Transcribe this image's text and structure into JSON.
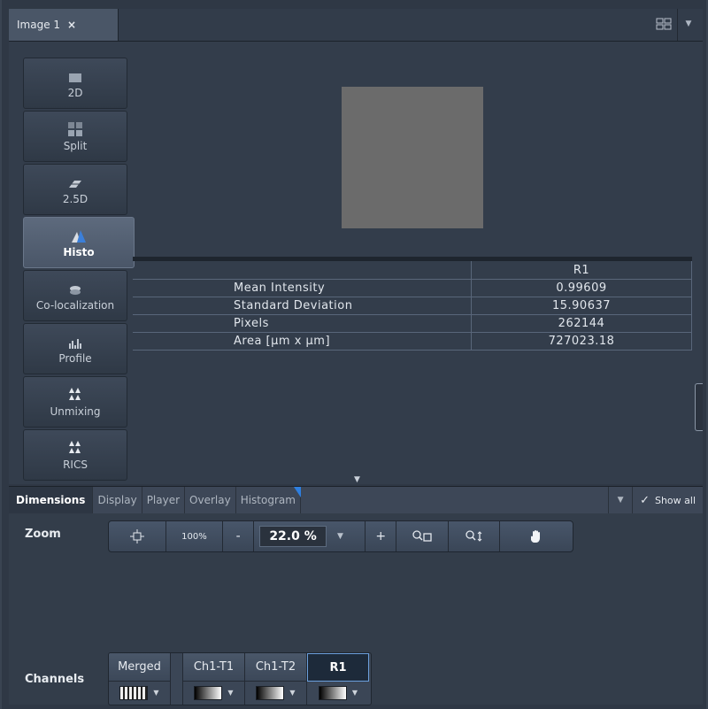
{
  "document_tab": {
    "title": "Image 1",
    "close": "×"
  },
  "view_modes": [
    {
      "label": "2D",
      "icon": "2d-view-icon",
      "active": false
    },
    {
      "label": "Split",
      "icon": "split-view-icon",
      "active": false
    },
    {
      "label": "2.5D",
      "icon": "2-5d-view-icon",
      "active": false
    },
    {
      "label": "Histo",
      "icon": "histogram-view-icon",
      "active": true
    },
    {
      "label": "Co-localization",
      "icon": "colocalization-icon",
      "active": false
    },
    {
      "label": "Profile",
      "icon": "profile-icon",
      "active": false
    },
    {
      "label": "Unmixing",
      "icon": "unmixing-icon",
      "active": false
    },
    {
      "label": "RICS",
      "icon": "rics-icon",
      "active": false
    }
  ],
  "stats_table": {
    "column_header": "R1",
    "rows": [
      {
        "label": "Mean Intensity",
        "value": "0.99609"
      },
      {
        "label": "Standard Deviation",
        "value": "15.90637"
      },
      {
        "label": "Pixels",
        "value": "262144"
      },
      {
        "label": "Area [µm x µm]",
        "value": "727023.18"
      }
    ]
  },
  "bottom_tabs": [
    "Dimensions",
    "Display",
    "Player",
    "Overlay",
    "Histogram"
  ],
  "active_bottom_tab": "Dimensions",
  "show_all_label": "Show all",
  "zoom": {
    "label": "Zoom",
    "fit_icon": "fit-to-window-icon",
    "hundred_label": "100%",
    "minus_label": "-",
    "value": "22.0 %",
    "plus_label": "+",
    "zoom_rect_icon": "zoom-rectangle-icon",
    "zoom_vert_icon": "zoom-vertical-icon",
    "pan_icon": "hand-pan-icon"
  },
  "channels": {
    "label": "Channels",
    "items": [
      {
        "name": "Merged",
        "lut": "multicolor",
        "selected": false
      },
      {
        "name": "Ch1-T1",
        "lut": "gray-gradient",
        "selected": false
      },
      {
        "name": "Ch1-T2",
        "lut": "gray-gradient",
        "selected": false
      },
      {
        "name": "R1",
        "lut": "gray-gradient",
        "selected": true
      }
    ]
  },
  "colors": {
    "preview_fill": "#6b6b6b",
    "accent": "#2e7fe0",
    "panel_bg": "#333d4a"
  }
}
